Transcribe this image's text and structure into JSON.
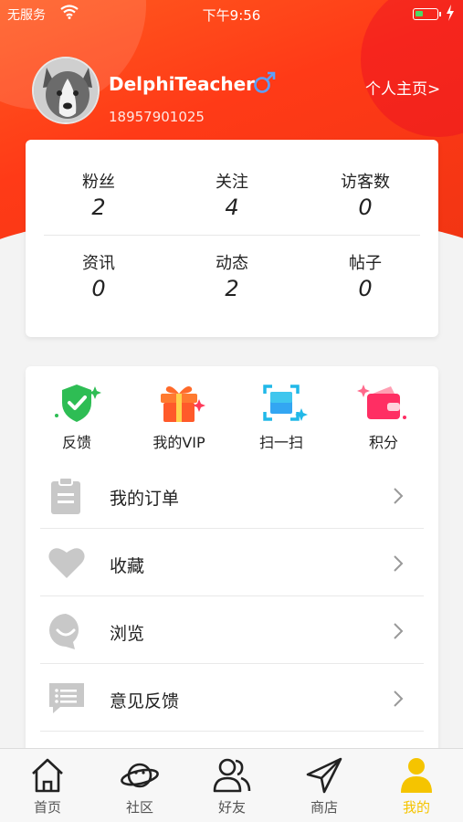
{
  "status_bar": {
    "carrier": "无服务",
    "time": "下午9:56"
  },
  "profile": {
    "username": "DelphiTeacher",
    "phone": "18957901025",
    "gender_symbol": "♂",
    "homepage_link": "个人主页>"
  },
  "stats": {
    "row1": [
      {
        "label": "粉丝",
        "value": "2"
      },
      {
        "label": "关注",
        "value": "4"
      },
      {
        "label": "访客数",
        "value": "0"
      }
    ],
    "row2": [
      {
        "label": "资讯",
        "value": "0"
      },
      {
        "label": "动态",
        "value": "2"
      },
      {
        "label": "帖子",
        "value": "0"
      }
    ]
  },
  "quick_actions": [
    {
      "label": "反馈",
      "icon": "shield-check-icon"
    },
    {
      "label": "我的VIP",
      "icon": "gift-icon"
    },
    {
      "label": "扫一扫",
      "icon": "scan-icon"
    },
    {
      "label": "积分",
      "icon": "wallet-icon"
    }
  ],
  "menu": [
    {
      "label": "我的订单",
      "icon": "clipboard-icon"
    },
    {
      "label": "收藏",
      "icon": "heart-icon"
    },
    {
      "label": "浏览",
      "icon": "smile-bubble-icon"
    },
    {
      "label": "意见反馈",
      "icon": "message-icon"
    }
  ],
  "tabs": [
    {
      "label": "首页",
      "icon": "home-icon",
      "active": false
    },
    {
      "label": "社区",
      "icon": "planet-icon",
      "active": false
    },
    {
      "label": "好友",
      "icon": "friends-icon",
      "active": false
    },
    {
      "label": "商店",
      "icon": "send-icon",
      "active": false
    },
    {
      "label": "我的",
      "icon": "user-icon",
      "active": true
    }
  ],
  "colors": {
    "header_accent": "#ff4a1c",
    "active_tab": "#f5c400",
    "gender_blue": "#5aa0ff"
  }
}
